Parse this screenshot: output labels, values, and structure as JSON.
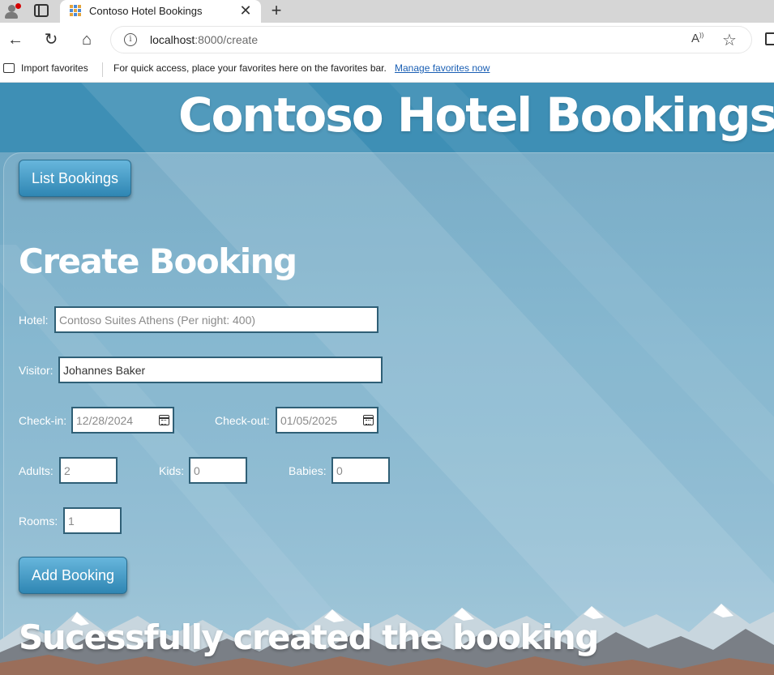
{
  "browser": {
    "tab_title": "Contoso Hotel Bookings",
    "url_host": "localhost",
    "url_rest": ":8000/create",
    "favorites_bar": {
      "import_label": "Import favorites",
      "message": "For quick access, place your favorites here on the favorites bar.",
      "link_label": "Manage favorites now"
    },
    "icons": [
      "profile-icon",
      "tab-actions-icon",
      "hotel-favicon",
      "close-icon",
      "plus-icon",
      "back-icon",
      "refresh-icon",
      "home-icon",
      "info-icon",
      "read-aloud-icon",
      "favorite-star-icon",
      "sidebar-icon",
      "import-favorites-icon"
    ]
  },
  "page": {
    "title": "Contoso Hotel Bookings",
    "list_button": "List Bookings",
    "form": {
      "heading": "Create Booking",
      "hotel_label": "Hotel:",
      "hotel_value": "Contoso Suites Athens (Per night: 400)",
      "visitor_label": "Visitor:",
      "visitor_value": "Johannes Baker",
      "checkin_label": "Check-in:",
      "checkin_value": "12/28/2024",
      "checkout_label": "Check-out:",
      "checkout_value": "01/05/2025",
      "adults_label": "Adults:",
      "adults_value": "2",
      "kids_label": "Kids:",
      "kids_value": "0",
      "babies_label": "Babies:",
      "babies_value": "0",
      "rooms_label": "Rooms:",
      "rooms_value": "1",
      "submit_label": "Add Booking"
    },
    "success_message": "Sucessfully created the booking",
    "colors": {
      "header": "#3e8fb5",
      "background": "#7db2cc",
      "button_top": "#67b6dc",
      "button_bottom": "#2f86b3",
      "field_border": "#2f5f76"
    }
  }
}
